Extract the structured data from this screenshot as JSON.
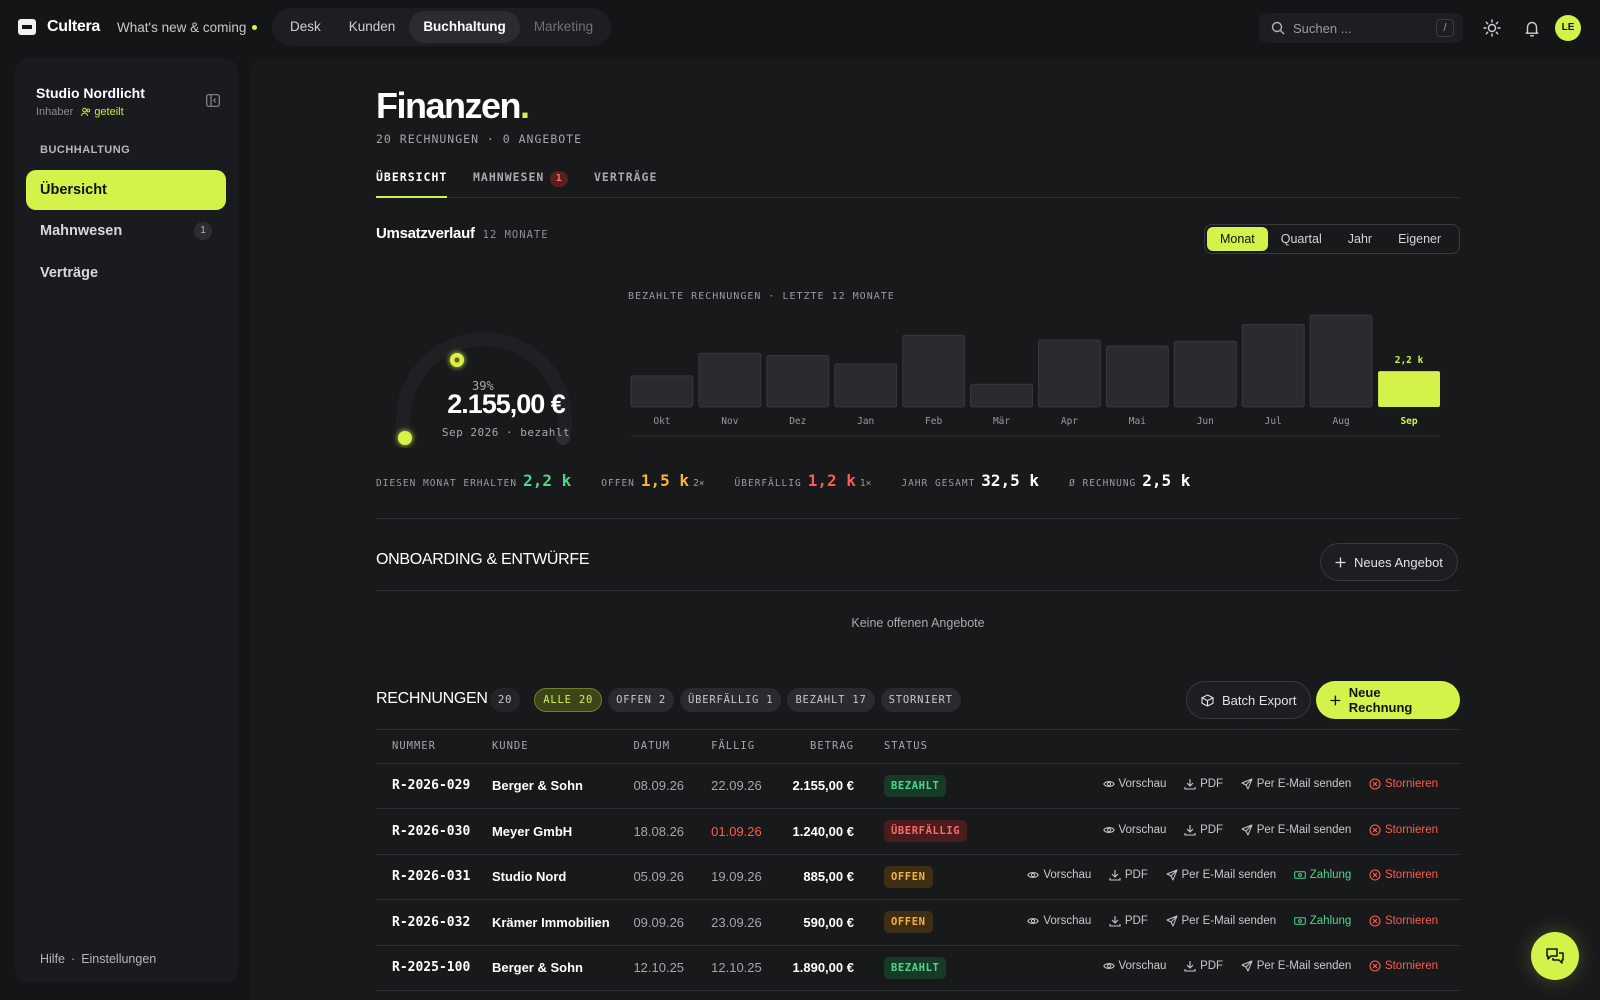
{
  "app": {
    "name": "Cultera",
    "whats_new": "What's new & coming"
  },
  "topnav": [
    {
      "label": "Desk",
      "state": "normal"
    },
    {
      "label": "Kunden",
      "state": "normal"
    },
    {
      "label": "Buchhaltung",
      "state": "active"
    },
    {
      "label": "Marketing",
      "state": "muted"
    }
  ],
  "search": {
    "placeholder": "Suchen ...",
    "shortcut": "/"
  },
  "user": {
    "initials": "LE"
  },
  "sidebar": {
    "workspace": "Studio Nordlicht",
    "role": "Inhaber",
    "shared": "geteilt",
    "section": "BUCHHALTUNG",
    "items": [
      {
        "label": "Übersicht",
        "active": true
      },
      {
        "label": "Mahnwesen",
        "badge": "1"
      },
      {
        "label": "Verträge"
      }
    ],
    "footer": {
      "help": "Hilfe",
      "sep": "·",
      "settings": "Einstellungen"
    }
  },
  "page": {
    "title": "Finanzen",
    "title_dot": ".",
    "subtitle": "20 RECHNUNGEN · 0 ANGEBOTE",
    "tabs": [
      {
        "label": "ÜBERSICHT",
        "active": true
      },
      {
        "label": "MAHNWESEN",
        "count": "1"
      },
      {
        "label": "VERTRÄGE"
      }
    ]
  },
  "revenue": {
    "title": "Umsatzverlauf",
    "meta": "12 MONATE",
    "periods": [
      "Monat",
      "Quartal",
      "Jahr",
      "Eigener"
    ],
    "active_period": "Monat",
    "gauge": {
      "percent_label": "39%",
      "percent": 0.39,
      "value": "2.155,00 €",
      "caption": "Sep 2026 · bezahlt"
    },
    "chart_caption": "BEZAHLTE RECHNUNGEN · LETZTE 12 MONATE",
    "highlight_label": "2,2 k"
  },
  "chart_data": {
    "type": "bar",
    "categories": [
      "Okt",
      "Nov",
      "Dez",
      "Jan",
      "Feb",
      "Mär",
      "Apr",
      "Mai",
      "Jun",
      "Jul",
      "Aug",
      "Sep"
    ],
    "values": [
      1.3,
      2.25,
      2.15,
      1.8,
      3.0,
      0.95,
      2.8,
      2.55,
      2.75,
      3.45,
      3.85,
      1.5
    ],
    "highlight_index": 11,
    "title": "BEZAHLTE RECHNUNGEN · LETZTE 12 MONATE",
    "unit": "k €",
    "colors": {
      "bar": "#2a2b2e",
      "highlight": "#d4f34a"
    }
  },
  "stats": [
    {
      "label": "DIESEN MONAT ERHALTEN",
      "value": "2,2 k",
      "color": "#4fd68a"
    },
    {
      "label": "OFFEN",
      "value": "1,5 k",
      "extra": "2×",
      "color": "#f6b23c"
    },
    {
      "label": "ÜBERFÄLLIG",
      "value": "1,2 k",
      "extra": "1×",
      "color": "#ff5a4f"
    },
    {
      "label": "JAHR GESAMT",
      "value": "32,5 k",
      "color": "#ffffff"
    },
    {
      "label": "Ø RECHNUNG",
      "value": "2,5 k",
      "color": "#ffffff"
    }
  ],
  "onboarding": {
    "title": "ONBOARDING & ENTWÜRFE",
    "new_offer": "Neues Angebot",
    "empty": "Keine offenen Angebote"
  },
  "invoices": {
    "title": "RECHNUNGEN",
    "count": "20",
    "filters": [
      "ALLE 20",
      "OFFEN 2",
      "ÜBERFÄLLIG 1",
      "BEZAHLT 17",
      "STORNIERT"
    ],
    "batch_export": "Batch Export",
    "new_invoice": "Neue Rechnung",
    "columns": [
      "NUMMER",
      "KUNDE",
      "DATUM",
      "FÄLLIG",
      "BETRAG",
      "STATUS"
    ],
    "action_labels": {
      "preview": "Vorschau",
      "pdf": "PDF",
      "email": "Per E-Mail senden",
      "pay": "Zahlung",
      "cancel": "Stornieren"
    },
    "rows": [
      {
        "number": "R-2026-029",
        "customer": "Berger & Sohn",
        "date": "08.09.26",
        "due": "22.09.26",
        "amount": "2.155,00 €",
        "status": "BEZAHLT",
        "kind": "paid"
      },
      {
        "number": "R-2026-030",
        "customer": "Meyer GmbH",
        "date": "18.08.26",
        "due": "01.09.26",
        "amount": "1.240,00 €",
        "status": "ÜBERFÄLLIG",
        "kind": "over"
      },
      {
        "number": "R-2026-031",
        "customer": "Studio Nord",
        "date": "05.09.26",
        "due": "19.09.26",
        "amount": "885,00 €",
        "status": "OFFEN",
        "kind": "open"
      },
      {
        "number": "R-2026-032",
        "customer": "Krämer Immobilien",
        "date": "09.09.26",
        "due": "23.09.26",
        "amount": "590,00 €",
        "status": "OFFEN",
        "kind": "open"
      },
      {
        "number": "R-2025-100",
        "customer": "Berger & Sohn",
        "date": "12.10.25",
        "due": "12.10.25",
        "amount": "1.890,00 €",
        "status": "BEZAHLT",
        "kind": "paid"
      }
    ]
  }
}
